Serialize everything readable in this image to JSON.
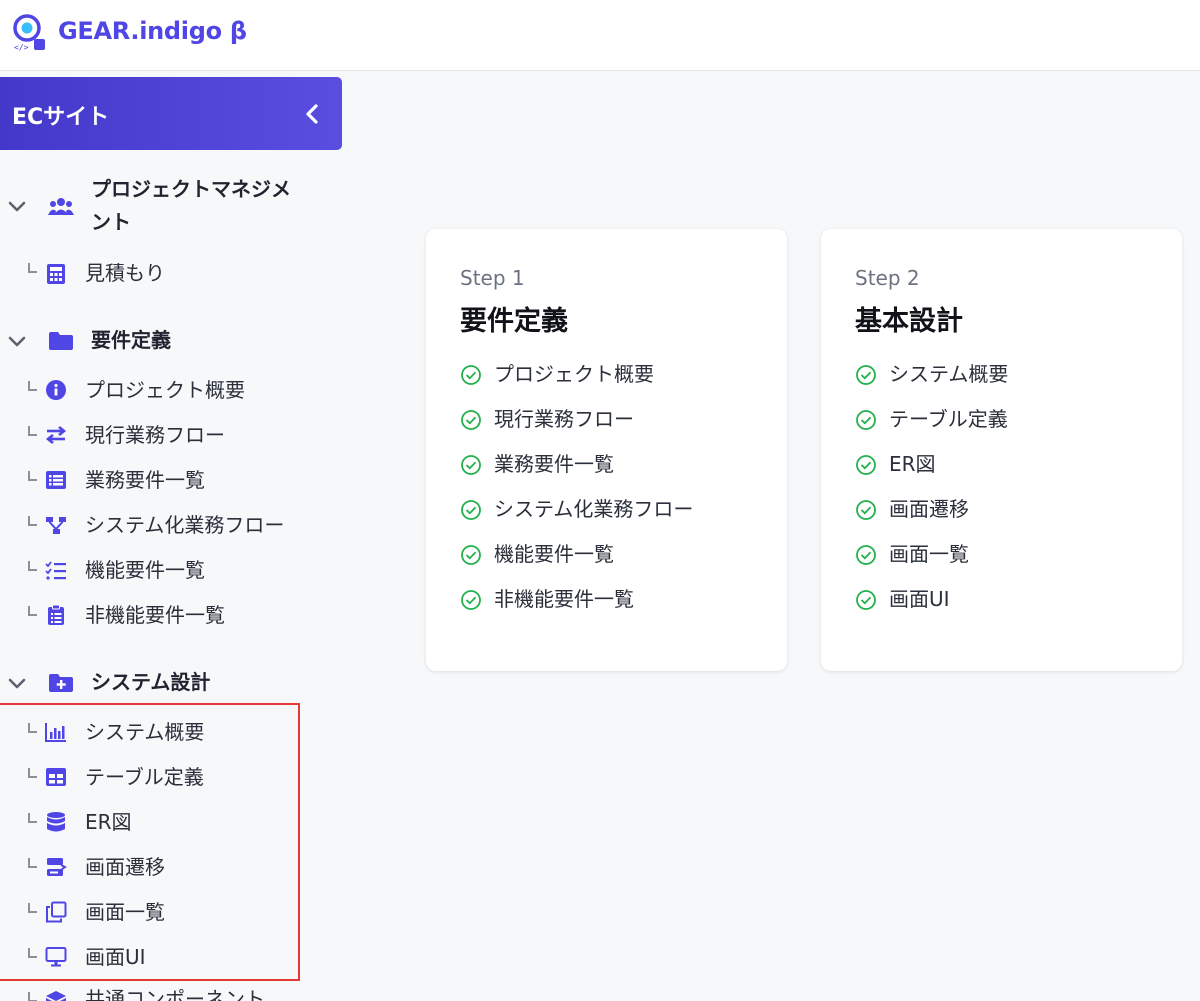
{
  "header": {
    "brand": "GEAR.indigo β"
  },
  "project": {
    "title": "ECサイト"
  },
  "sidebar": {
    "groups": [
      {
        "label": "プロジェクトマネジメント",
        "label_line1": "プロジェクトマネジメ",
        "label_line2": "ント",
        "icon": "users-icon",
        "items": [
          {
            "label": "見積もり",
            "icon": "calculator-icon"
          }
        ]
      },
      {
        "label": "要件定義",
        "icon": "folder-icon",
        "items": [
          {
            "label": "プロジェクト概要",
            "icon": "info-icon"
          },
          {
            "label": "現行業務フロー",
            "icon": "exchange-icon"
          },
          {
            "label": "業務要件一覧",
            "icon": "list-icon"
          },
          {
            "label": "システム化業務フロー",
            "icon": "sitemap-icon"
          },
          {
            "label": "機能要件一覧",
            "icon": "checklist-icon"
          },
          {
            "label": "非機能要件一覧",
            "icon": "clipboard-list-icon"
          }
        ]
      },
      {
        "label": "システム設計",
        "icon": "folder-plus-icon",
        "items": [
          {
            "label": "システム概要",
            "icon": "bar-chart-icon"
          },
          {
            "label": "テーブル定義",
            "icon": "table-icon"
          },
          {
            "label": "ER図",
            "icon": "database-icon"
          },
          {
            "label": "画面遷移",
            "icon": "screen-transition-icon"
          },
          {
            "label": "画面一覧",
            "icon": "copy-icon"
          },
          {
            "label": "画面UI",
            "icon": "monitor-icon"
          }
        ]
      },
      {
        "label": "共通コンポーネント",
        "icon": "cube-icon",
        "items": []
      }
    ]
  },
  "cards": [
    {
      "step": "Step 1",
      "title": "要件定義",
      "items": [
        "プロジェクト概要",
        "現行業務フロー",
        "業務要件一覧",
        "システム化業務フロー",
        "機能要件一覧",
        "非機能要件一覧"
      ]
    },
    {
      "step": "Step 2",
      "title": "基本設計",
      "items": [
        "システム概要",
        "テーブル定義",
        "ER図",
        "画面遷移",
        "画面一覧",
        "画面UI"
      ]
    }
  ],
  "colors": {
    "accent": "#4f46e5",
    "project_bar_start": "#4338ca",
    "project_bar_end": "#5a4ee0",
    "check": "#22b14c",
    "highlight": "#e53935",
    "background": "#f7f8fa"
  }
}
